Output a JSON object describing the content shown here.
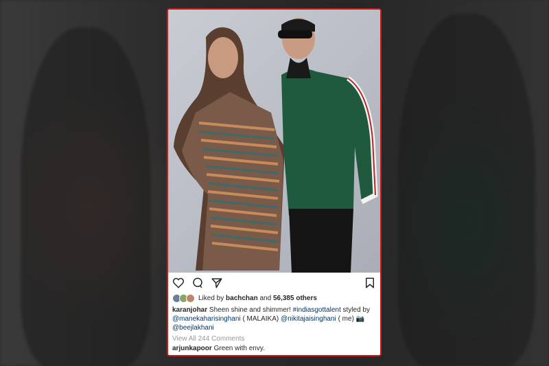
{
  "post": {
    "likes": {
      "prefix": "Liked by",
      "user": "bachchan",
      "joiner": "and",
      "count": "56,385 others"
    },
    "caption": {
      "author": "karanjohar",
      "text": "Sheen shine and shimmer!",
      "hashtag": "#indiasgottalent",
      "styled_by": "styled by",
      "mention1": "@manekaharisinghani",
      "mention1_note": "( MALAIKA)",
      "mention2": "@nikitajaisinghani",
      "mention2_note": "( me)",
      "emoji": "📷",
      "mention3": "@beejlakhani"
    },
    "view_comments": "View All 244 Comments",
    "comment": {
      "author": "arjunkapoor",
      "text": "Green with envy."
    },
    "icons": [
      "heart-icon",
      "comment-icon",
      "share-icon",
      "bookmark-icon"
    ]
  },
  "colors": {
    "frame_border": "#d01a1a",
    "link": "#003569",
    "muted": "#999999"
  }
}
